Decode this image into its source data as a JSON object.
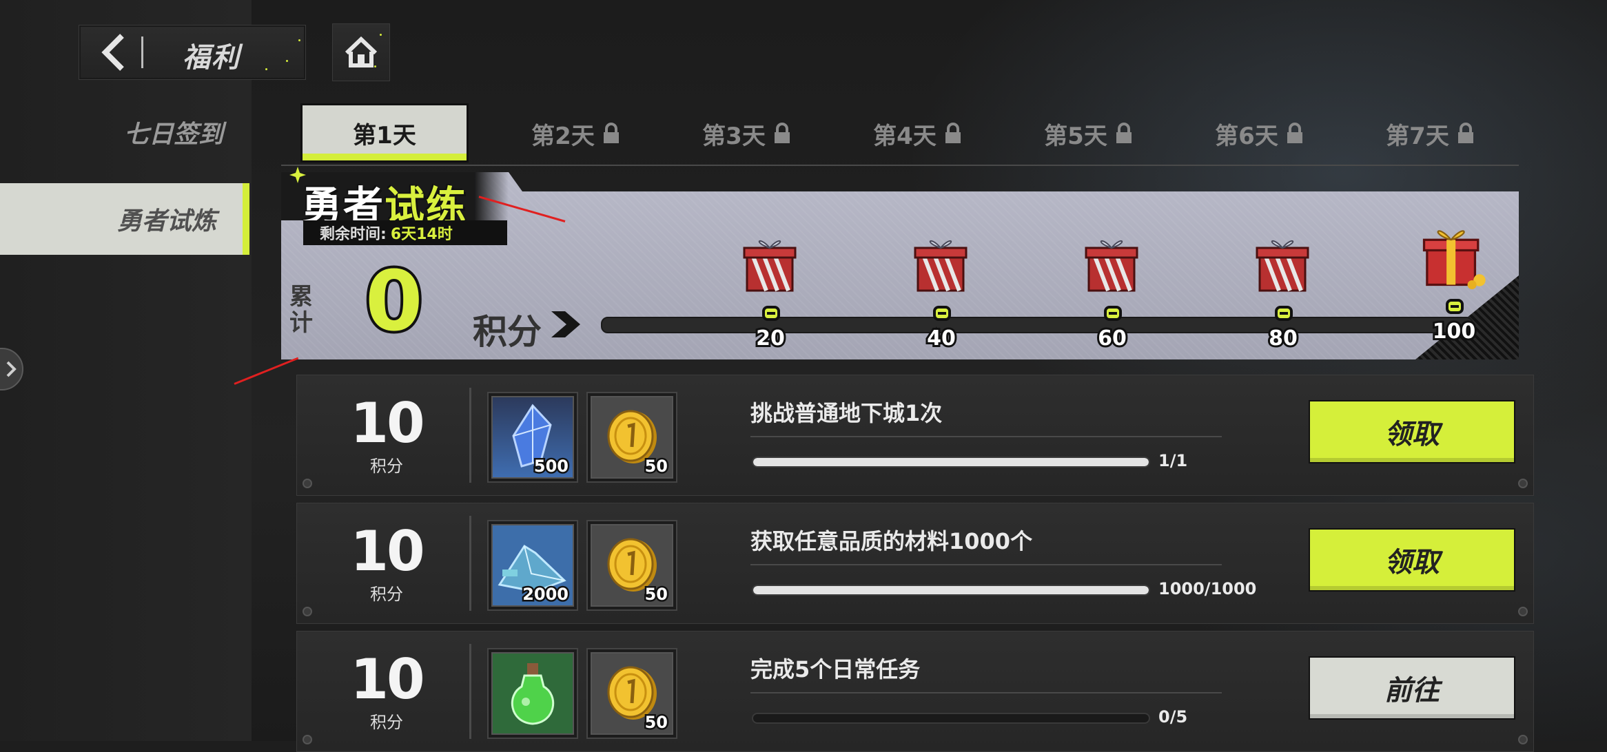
{
  "header": {
    "title": "福利",
    "back_icon": "back-arrow-icon",
    "home_icon": "home-icon"
  },
  "sidebar": {
    "items": [
      {
        "label": "七日签到",
        "active": false
      },
      {
        "label": "勇者试炼",
        "active": true
      }
    ]
  },
  "day_tabs": [
    {
      "label": "第1天",
      "locked": false,
      "active": true
    },
    {
      "label": "第2天",
      "locked": true
    },
    {
      "label": "第3天",
      "locked": true
    },
    {
      "label": "第4天",
      "locked": true
    },
    {
      "label": "第5天",
      "locked": true
    },
    {
      "label": "第6天",
      "locked": true
    },
    {
      "label": "第7天",
      "locked": true
    }
  ],
  "banner": {
    "title_a": "勇者",
    "title_b": "试练",
    "remaining_label": "剩余时间:",
    "remaining_value": "6天14时",
    "cumulative_label": "累计",
    "cumulative_value": "0",
    "score_label": "积分",
    "milestones": [
      "20",
      "40",
      "60",
      "80",
      "100"
    ]
  },
  "tasks": [
    {
      "points": "10",
      "points_label": "积分",
      "rewards": [
        {
          "icon": "blue-crystal-icon",
          "qty": "500"
        },
        {
          "icon": "gold-coin-icon",
          "qty": "50"
        }
      ],
      "desc": "挑战普通地下城1次",
      "count": "1/1",
      "progress": 1.0,
      "button": "领取",
      "button_type": "claim"
    },
    {
      "points": "10",
      "points_label": "积分",
      "rewards": [
        {
          "icon": "blue-ore-icon",
          "qty": "2000"
        },
        {
          "icon": "gold-coin-icon",
          "qty": "50"
        }
      ],
      "desc": "获取任意品质的材料1000个",
      "count": "1000/1000",
      "progress": 1.0,
      "button": "领取",
      "button_type": "claim"
    },
    {
      "points": "10",
      "points_label": "积分",
      "rewards": [
        {
          "icon": "green-potion-icon",
          "qty": ""
        },
        {
          "icon": "gold-coin-icon",
          "qty": "50"
        }
      ],
      "desc": "完成5个日常任务",
      "count": "0/5",
      "progress": 0.0,
      "button": "前往",
      "button_type": "go"
    }
  ],
  "colors": {
    "accent": "#d5ef3a",
    "panel": "#2e2e2e",
    "banner": "#b0b1c0",
    "annotation_arrow": "#e02020"
  }
}
